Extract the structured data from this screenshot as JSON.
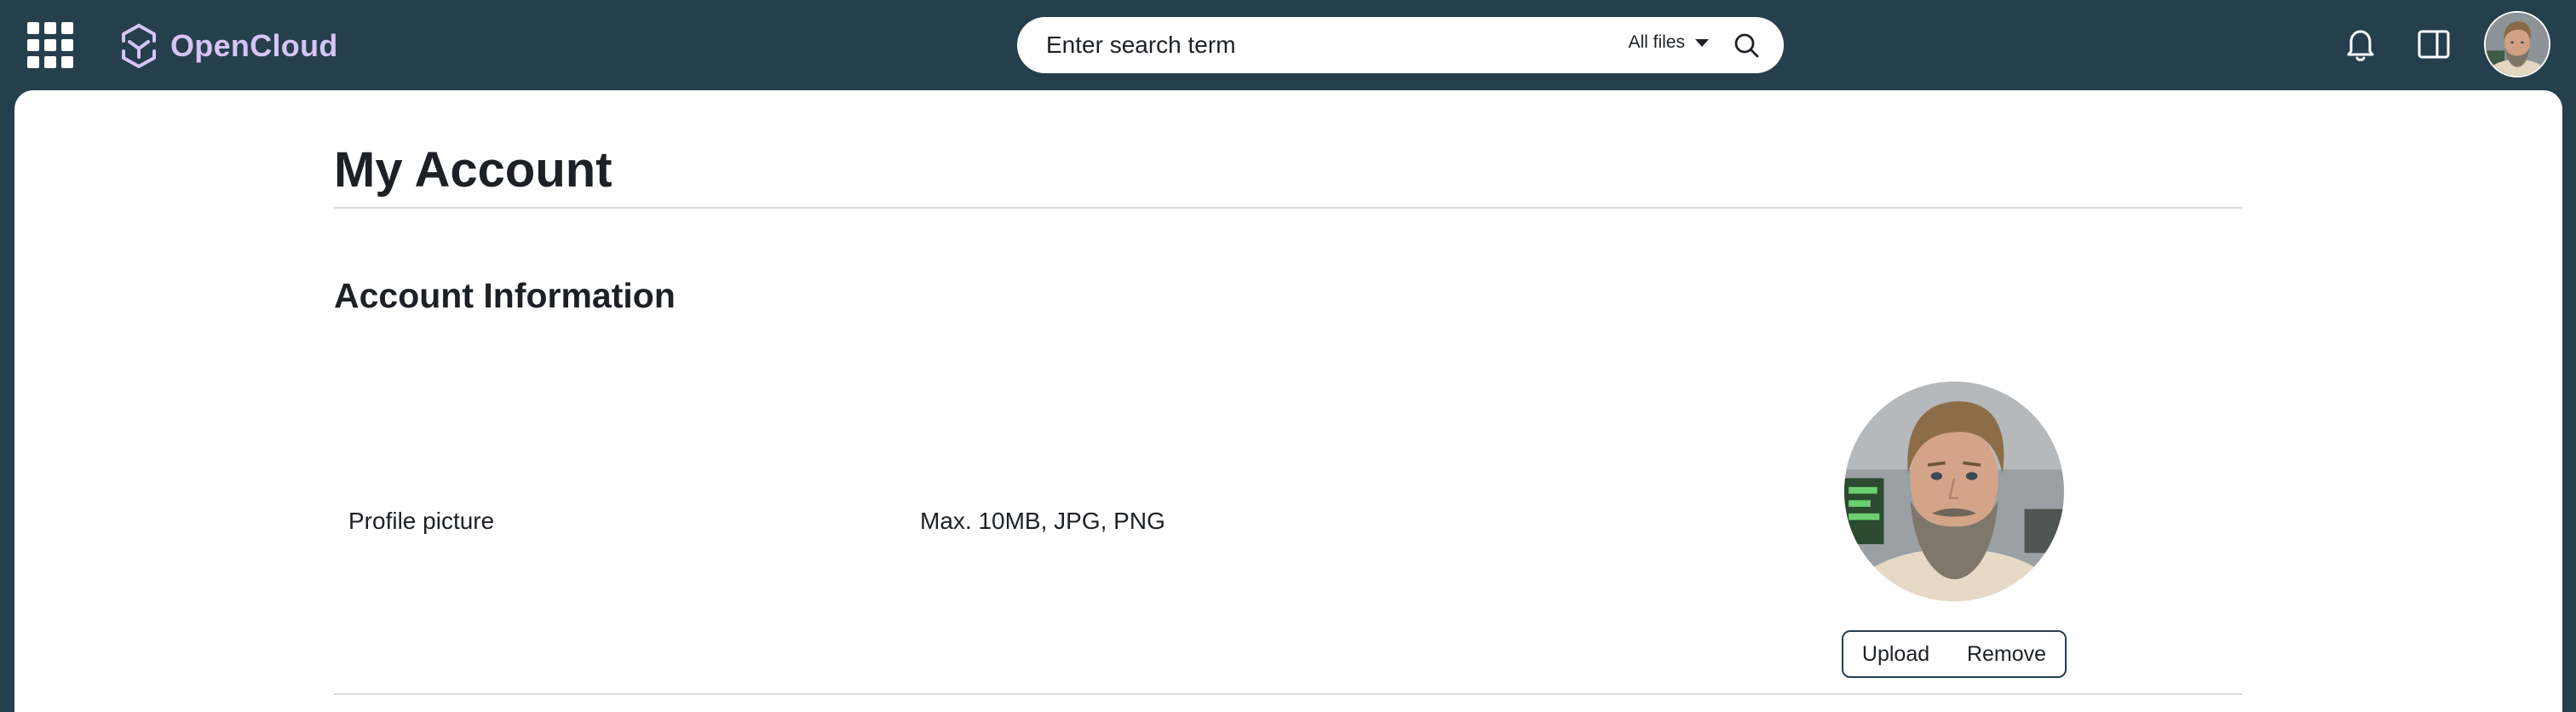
{
  "app": {
    "brand_name": "OpenCloud"
  },
  "search": {
    "placeholder": "Enter search term",
    "scope_label": "All files"
  },
  "page": {
    "title": "My Account",
    "section_title": "Account Information"
  },
  "profile_picture": {
    "label": "Profile picture",
    "hint": "Max. 10MB, JPG, PNG",
    "upload_label": "Upload",
    "remove_label": "Remove"
  },
  "icons": {
    "apps": "grid-icon",
    "logo": "opencloud-logo-icon",
    "search": "search-icon",
    "notifications": "bell-icon",
    "sidebar": "sidebar-toggle-icon",
    "avatar": "user-avatar"
  },
  "colors": {
    "topbar": "#263f4c",
    "brand": "#d5c4f5",
    "content_bg": "#ffffff",
    "text": "#1d2125"
  }
}
